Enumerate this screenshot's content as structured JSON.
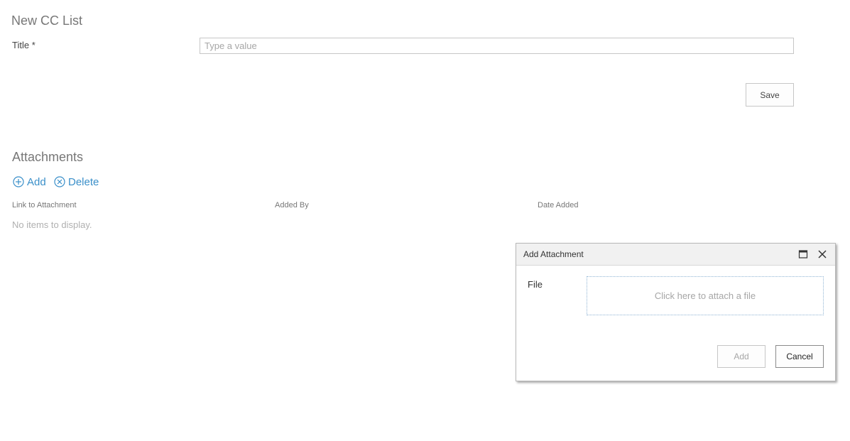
{
  "form": {
    "title": "New CC List",
    "fields": {
      "title_label": "Title *",
      "title_placeholder": "Type a value",
      "title_value": ""
    },
    "save_label": "Save"
  },
  "attachments": {
    "section_title": "Attachments",
    "add_label": "Add",
    "delete_label": "Delete",
    "columns": [
      "Link to Attachment",
      "Added By",
      "Date Added"
    ],
    "empty_message": "No items to display."
  },
  "dialog": {
    "title": "Add Attachment",
    "file_label": "File",
    "attach_prompt": "Click here to attach a file",
    "add_label": "Add",
    "cancel_label": "Cancel"
  },
  "colors": {
    "accent": "#3a8fc9",
    "muted_text": "#777777",
    "placeholder": "#a6a6a6",
    "border": "#c6c6c6"
  },
  "icons": {
    "add": "circle-plus-icon",
    "delete": "circle-x-icon",
    "maximize": "maximize-icon",
    "close": "close-icon"
  }
}
